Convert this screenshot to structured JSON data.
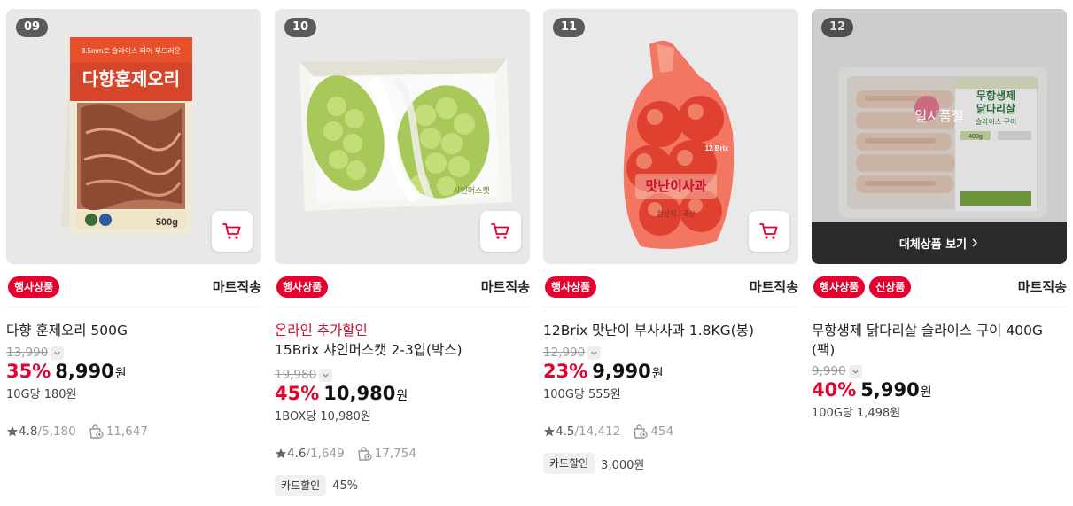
{
  "products": [
    {
      "rank": "09",
      "tags": [
        "행사상품"
      ],
      "seller": "마트직송",
      "promo": "",
      "name": "다향 훈제오리 500G",
      "original_price": "13,990",
      "discount": "35%",
      "price": "8,990",
      "currency": "원",
      "unit_price": "10G당 180원",
      "rating": "4.8",
      "review_count": "5,180",
      "purchase_count": "11,647",
      "card_label": "",
      "card_value": "",
      "sold_out": false
    },
    {
      "rank": "10",
      "tags": [
        "행사상품"
      ],
      "seller": "마트직송",
      "promo": "온라인 추가할인",
      "name": "15Brix 샤인머스캣 2-3입(박스)",
      "original_price": "19,980",
      "discount": "45%",
      "price": "10,980",
      "currency": "원",
      "unit_price": "1BOX당 10,980원",
      "rating": "4.6",
      "review_count": "1,649",
      "purchase_count": "17,754",
      "card_label": "카드할인",
      "card_value": "45%",
      "sold_out": false
    },
    {
      "rank": "11",
      "tags": [
        "행사상품"
      ],
      "seller": "마트직송",
      "promo": "",
      "name": "12Brix 맛난이 부사사과 1.8KG(봉)",
      "original_price": "12,990",
      "discount": "23%",
      "price": "9,990",
      "currency": "원",
      "unit_price": "100G당 555원",
      "rating": "4.5",
      "review_count": "14,412",
      "purchase_count": "454",
      "card_label": "카드할인",
      "card_value": "3,000원",
      "sold_out": false
    },
    {
      "rank": "12",
      "tags": [
        "행사상품",
        "신상품"
      ],
      "seller": "마트직송",
      "promo": "",
      "name": "무항생제 닭다리살 슬라이스 구이 400G (팩)",
      "original_price": "9,990",
      "discount": "40%",
      "price": "5,990",
      "currency": "원",
      "unit_price": "100G당 1,498원",
      "rating": "",
      "review_count": "",
      "purchase_count": "",
      "card_label": "",
      "card_value": "",
      "sold_out": true,
      "sold_out_label": "일시품절",
      "alternative_label": "대체상품 보기"
    }
  ],
  "package_text": {
    "p1_brand": "다향훈제오리",
    "p1_sub": "3.5mm로 슬라이스 되어 부드러운",
    "p1_weight": "500g",
    "p2_label": "샤인머스캣",
    "p3_label": "맛난이사과",
    "p3_brix": "12 Brix",
    "p3_origin": "원산지 : 국산",
    "p4_label1": "무항생제",
    "p4_label2": "닭다리살",
    "p4_label3": "슬라이스 구이",
    "p4_weight": "400g"
  },
  "colors": {
    "accent_red": "#e6002d",
    "promo_red": "#c8102e",
    "dark_bar": "#2b2b2b"
  }
}
